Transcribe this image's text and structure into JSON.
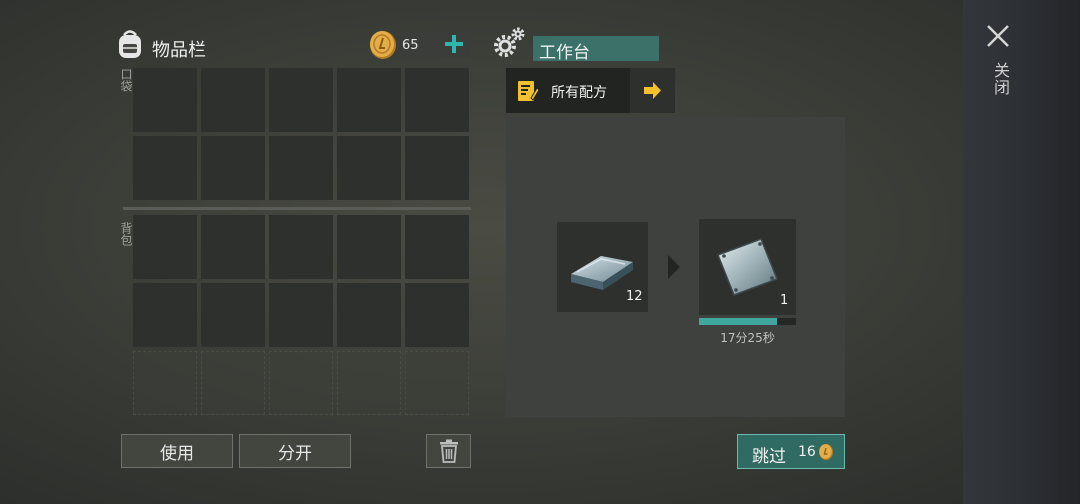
{
  "side_panel": {
    "close_label": "关闭",
    "close_icon": "close-icon"
  },
  "inventory": {
    "title": "物品栏",
    "coins": "65",
    "pocket_label": "口袋",
    "backpack_label": "背包",
    "use_button": "使用",
    "split_button": "分开"
  },
  "workbench": {
    "title": "工作台",
    "recipes_tab_label": "所有配方",
    "ingredient_item": "iron-ingot-icon",
    "ingredient_count": "12",
    "product_item": "metal-plate-icon",
    "product_count": "1",
    "progress_fraction": 0.8,
    "timer": "17分25秒",
    "skip_label": "跳过",
    "skip_cost": "16"
  },
  "colors": {
    "accent_teal": "#3b7168",
    "progress_teal": "#3fa6a0",
    "coin_gold": "#d9a441",
    "arrow_yellow": "#f2c12e"
  }
}
